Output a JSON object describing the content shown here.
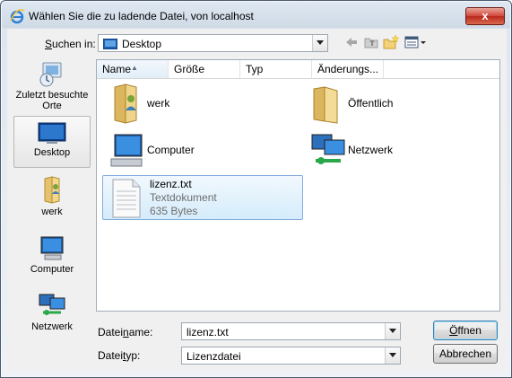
{
  "window": {
    "title": "Wählen Sie die zu ladende Datei, von localhost",
    "close_label": "x"
  },
  "lookin": {
    "label_prefix": "",
    "label_u": "S",
    "label_rest": "uchen in:",
    "value": "Desktop"
  },
  "toolbar": {
    "icons": [
      "back-arrow-icon",
      "up-folder-icon",
      "new-folder-icon",
      "view-menu-icon"
    ]
  },
  "places": [
    {
      "label": "Zuletzt besuchte Orte",
      "icon": "recent-places-icon"
    },
    {
      "label": "Desktop",
      "icon": "desktop-icon",
      "selected": true
    },
    {
      "label": "werk",
      "icon": "user-folder-icon"
    },
    {
      "label": "Computer",
      "icon": "computer-icon"
    },
    {
      "label": "Netzwerk",
      "icon": "network-icon"
    }
  ],
  "columns": [
    "Name",
    "Größe",
    "Typ",
    "Änderungs..."
  ],
  "items": [
    {
      "name": "werk",
      "icon": "user-folder-icon"
    },
    {
      "name": "Öffentlich",
      "icon": "folder-icon"
    },
    {
      "name": "Computer",
      "icon": "computer-icon"
    },
    {
      "name": "Netzwerk",
      "icon": "network-icon"
    },
    {
      "name": "lizenz.txt",
      "type": "Textdokument",
      "size": "635 Bytes",
      "icon": "text-file-icon",
      "selected": true
    }
  ],
  "filename": {
    "label_pre": "Datei",
    "label_u": "n",
    "label_post": "ame:",
    "value": "lizenz.txt"
  },
  "filetype": {
    "label_pre": "Datei",
    "label_u": "t",
    "label_post": "yp:",
    "value": "Lizenzdatei"
  },
  "buttons": {
    "open_u": "Ö",
    "open_rest": "ffnen",
    "cancel": "Abbrechen"
  }
}
